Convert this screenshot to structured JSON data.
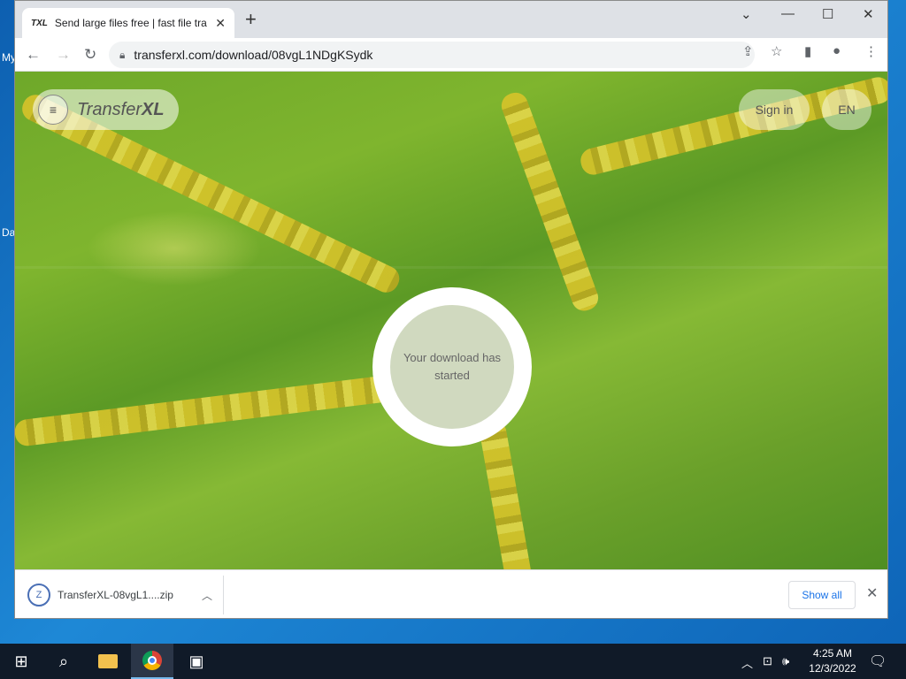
{
  "desktop": {
    "labels": [
      "My",
      "Da"
    ]
  },
  "browser": {
    "tab": {
      "favicon_text": "TXL",
      "title": "Send large files free | fast file tra"
    },
    "url": "transferxl.com/download/08vgL1NDgKSydk"
  },
  "site": {
    "logo_light": "Transfer",
    "logo_bold": "XL",
    "signin_label": "Sign in",
    "language_label": "EN",
    "download_message": "Your download has started"
  },
  "download_shelf": {
    "file_name": "TransferXL-08vgL1....zip",
    "show_all_label": "Show all"
  },
  "taskbar": {
    "time": "4:25 AM",
    "date": "12/3/2022"
  },
  "colors": {
    "accent": "#1a73e8",
    "taskbar": "#101a28",
    "field_green": "#6ea82a"
  }
}
